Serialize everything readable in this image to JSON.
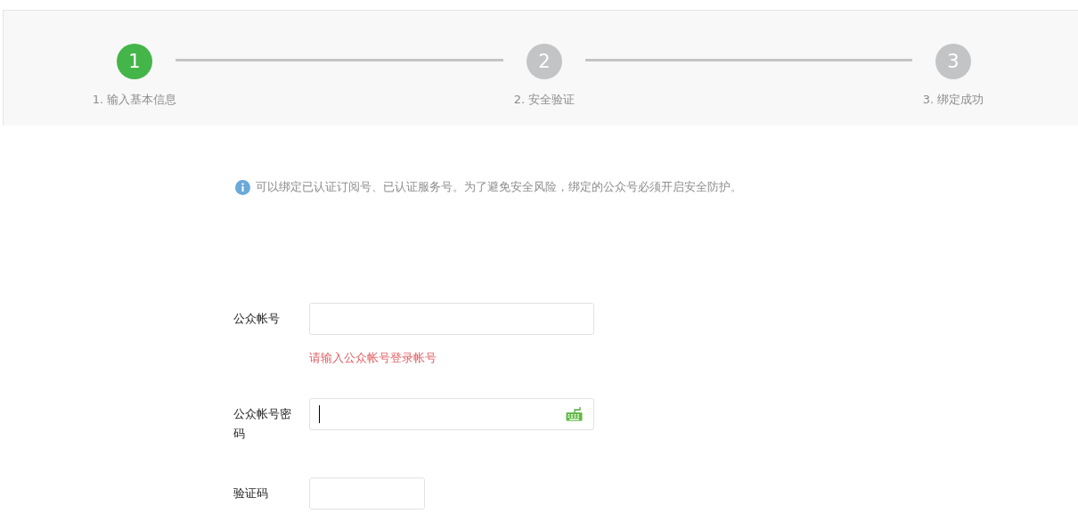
{
  "steps": [
    {
      "number": "1",
      "label": "1. 输入基本信息",
      "selected": true
    },
    {
      "number": "2",
      "label": "2. 安全验证",
      "selected": false
    },
    {
      "number": "3",
      "label": "3. 绑定成功",
      "selected": false
    }
  ],
  "notice": "可以绑定已认证订阅号、已认证服务号。为了避免安全风险，绑定的公众号必须开启安全防护。",
  "fields": [
    {
      "kind": "text",
      "label": "公众帐号",
      "focused": false,
      "error": "请输入公众帐号登录帐号"
    },
    {
      "kind": "password",
      "label": "公众帐号密码",
      "focused": true
    },
    {
      "kind": "captcha",
      "label": "验证码",
      "focused": false
    }
  ]
}
